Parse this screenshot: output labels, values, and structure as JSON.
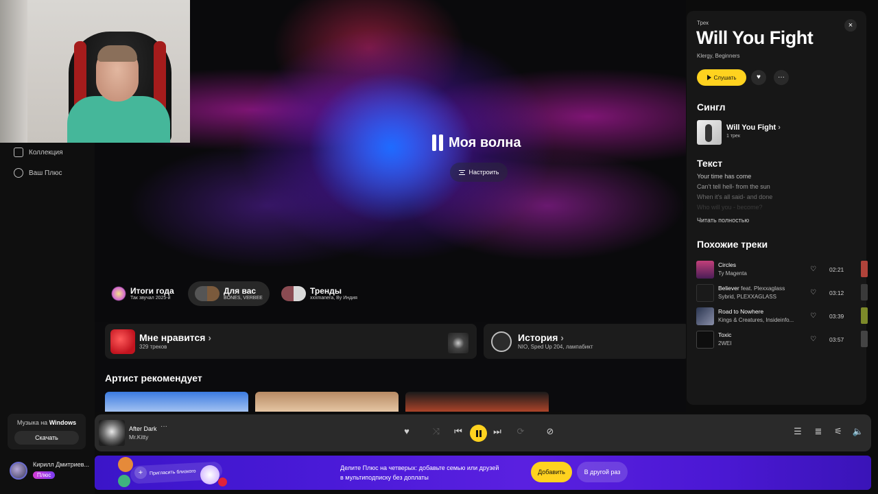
{
  "sidebar": {
    "items": [
      {
        "label": "Коллекция",
        "icon": "heart-icon"
      },
      {
        "label": "Ваш Плюс",
        "icon": "plus-circle-icon"
      }
    ],
    "promo": {
      "text_prefix": "Музыка на",
      "text_bold": "Windows",
      "button": "Скачать"
    },
    "user": {
      "name": "Кирилл Дмитриев...",
      "badge": "Плюс"
    }
  },
  "wave": {
    "title": "Моя волна",
    "tune_button": "Настроить"
  },
  "chips": [
    {
      "title": "Итоги года",
      "subtitle": "Так звучал 2025-й"
    },
    {
      "title": "Для вас",
      "subtitle": "BONES, VERBEE"
    },
    {
      "title": "Тренды",
      "subtitle": "xxxmanera, By Индия"
    }
  ],
  "cards": [
    {
      "title": "Мне нравится",
      "chevron": "›",
      "subtitle": "329 треков"
    },
    {
      "title": "История",
      "chevron": "›",
      "subtitle": "NIO, Sped Up 204, лампабикт"
    }
  ],
  "artist_section": {
    "title": "Артист рекомендует"
  },
  "panel": {
    "label": "Трек",
    "title": "Will You Fight",
    "artists": "Klergy, Beginners",
    "play_button": "Слушать",
    "close": "×",
    "more": "···",
    "single_heading": "Сингл",
    "single": {
      "name": "Will You Fight",
      "chevron": "›",
      "sub": "1 трек"
    },
    "lyrics_heading": "Текст",
    "lyrics": [
      "Your time has come",
      "Can't tell hell- from the sun",
      "When it's all said- and done",
      "Who will you - become?"
    ],
    "read_full": "Читать полностью",
    "similar_heading": "Похожие треки",
    "similar": [
      {
        "name": "Circles",
        "artist": "Ty Magenta",
        "duration": "02:21",
        "color": "#c2407a"
      },
      {
        "name": "Believer",
        "feat": " feat. Plexxaglass",
        "artist": "Sybrid, PLEXXAGLASS",
        "duration": "03:12",
        "color": "#1a1a1a"
      },
      {
        "name": "Road to Nowhere",
        "artist": "Kings & Creatures, Insideinfo...",
        "duration": "03:39",
        "color": "#2a3550"
      },
      {
        "name": "Toxic",
        "artist": "2WEI",
        "duration": "03:57",
        "color": "#0e0e0e"
      }
    ]
  },
  "player": {
    "track": "After Dark",
    "artist": "Mr.Kitty",
    "more": "···"
  },
  "banner": {
    "invite": "Пригласить близкого",
    "text_line1": "Делите Плюс на четверых: добавьте семью или друзей",
    "text_line2": "в мультиподписку без доплаты",
    "add_button": "Добавить",
    "later_button": "В другой раз"
  },
  "colors": {
    "accent": "#ffd21f",
    "banner": "#4a1ad8",
    "panel_bg": "#171717"
  }
}
